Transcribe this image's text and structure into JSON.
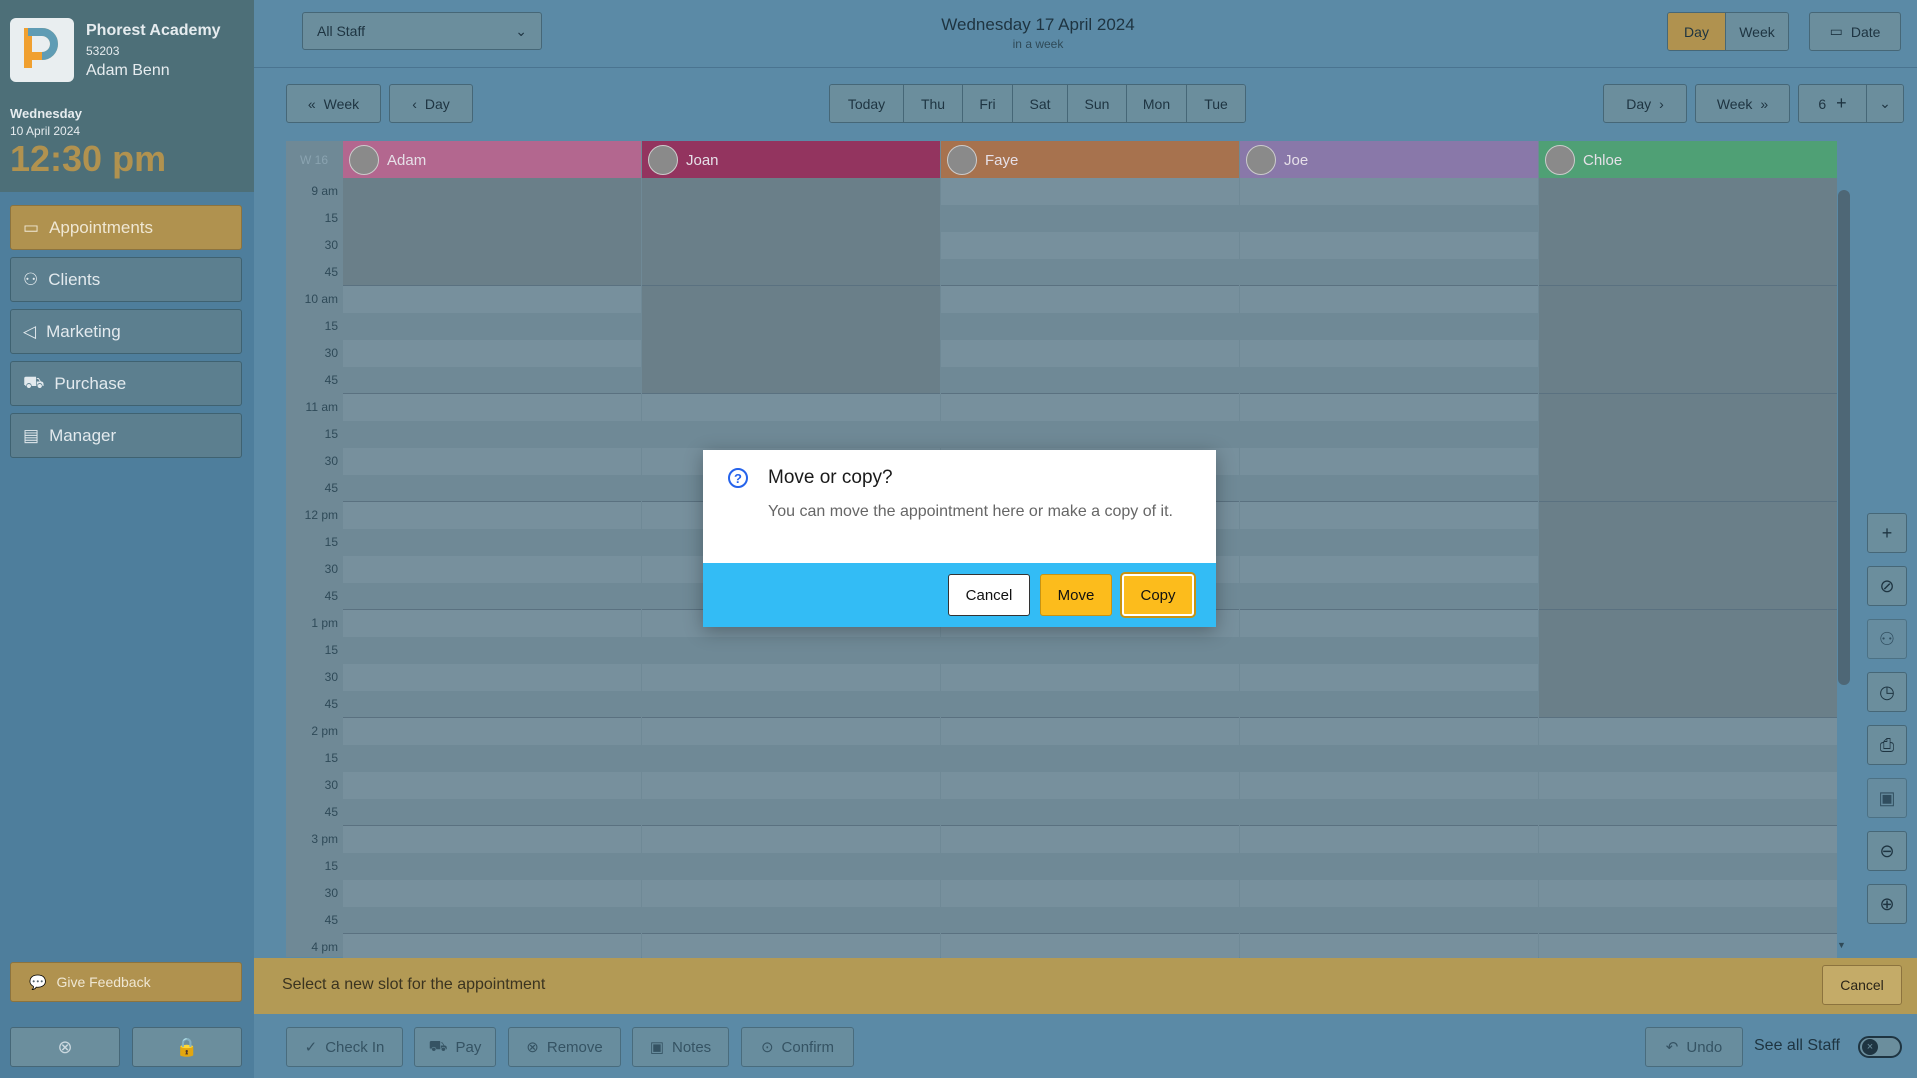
{
  "sidebar": {
    "brand_name": "Phorest Academy",
    "brand_id": "53203",
    "user": "Adam Benn",
    "weekday": "Wednesday",
    "date": "10 April 2024",
    "time": "12:30 pm",
    "nav": [
      {
        "label": "Appointments",
        "icon": "calendar-icon",
        "active": true
      },
      {
        "label": "Clients",
        "icon": "users-icon",
        "active": false
      },
      {
        "label": "Marketing",
        "icon": "megaphone-icon",
        "active": false
      },
      {
        "label": "Purchase",
        "icon": "cart-icon",
        "active": false
      },
      {
        "label": "Manager",
        "icon": "briefcase-icon",
        "active": false
      }
    ],
    "feedback_label": "Give Feedback"
  },
  "topbar": {
    "staff_select": "All Staff",
    "title": "Wednesday 17 April 2024",
    "subtitle": "in a week",
    "view_day": "Day",
    "view_week": "Week",
    "date_label": "Date"
  },
  "navrow": {
    "prev_week": "Week",
    "prev_day": "Day",
    "days": [
      "Today",
      "Thu",
      "Fri",
      "Sat",
      "Sun",
      "Mon",
      "Tue"
    ],
    "next_day": "Day",
    "next_week": "Week",
    "count": "6"
  },
  "calendar": {
    "week_label": "W 16",
    "staff": [
      {
        "name": "Adam",
        "color": "#b3678f"
      },
      {
        "name": "Joan",
        "color": "#93345f"
      },
      {
        "name": "Faye",
        "color": "#a7724e"
      },
      {
        "name": "Joe",
        "color": "#8978a9"
      },
      {
        "name": "Chloe",
        "color": "#4fa075"
      }
    ],
    "times": [
      "9 am",
      "15",
      "30",
      "45",
      "10 am",
      "15",
      "30",
      "45",
      "11 am",
      "15",
      "30",
      "45",
      "12 pm",
      "15",
      "30",
      "45",
      "1 pm",
      "15",
      "30",
      "45",
      "2 pm",
      "15",
      "30",
      "45",
      "3 pm",
      "15",
      "30",
      "45",
      "4 pm"
    ]
  },
  "notice": {
    "text": "Select a new slot for the appointment",
    "cancel": "Cancel"
  },
  "footer": {
    "buttons": [
      "Check In",
      "Pay",
      "Remove",
      "Notes",
      "Confirm"
    ],
    "undo": "Undo",
    "see_all": "See all Staff"
  },
  "dialog": {
    "title": "Move or copy?",
    "message": "You can move the appointment here or make a copy of it.",
    "cancel": "Cancel",
    "move": "Move",
    "copy": "Copy",
    "accent": "#33bcf5",
    "button_color": "#fcbc1c"
  }
}
